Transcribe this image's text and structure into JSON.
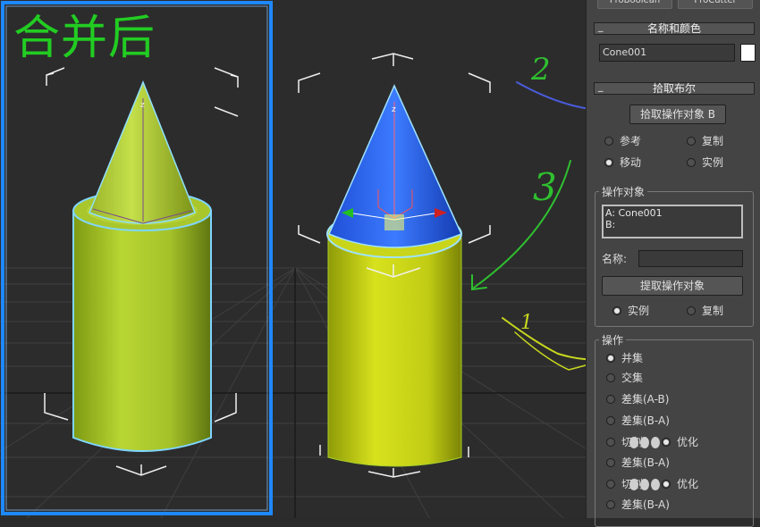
{
  "viewport": {
    "label_merged": "合并后",
    "annotations": {
      "num_2": "2",
      "num_3": "3",
      "num_1": "1"
    }
  },
  "panel": {
    "top_buttons": {
      "left": "ProBoolean",
      "right": "ProCutter"
    },
    "name_color": {
      "header": "名称和颜色",
      "object_name": "Cone001",
      "swatch_color": "#ffffff"
    },
    "pick_boolean": {
      "header": "拾取布尔",
      "pick_button": "拾取操作对象 B",
      "options": {
        "ref": "参考",
        "copy": "复制",
        "move": "移动",
        "instance": "实例"
      },
      "selected": "move"
    },
    "operands": {
      "title": "操作对象",
      "list": [
        "A: Cone001",
        "B:"
      ],
      "name_label": "名称:",
      "name_value": "",
      "extract_button": "提取操作对象",
      "opt_instance": "实例",
      "opt_copy": "复制",
      "selected": "instance"
    },
    "operation": {
      "title": "操作",
      "items": [
        "并集",
        "交集",
        "差集(A-B)",
        "差集(B-A)",
        "切割",
        "差集(B-A)",
        "切割",
        "差集(B-A)"
      ],
      "cut_option": "优化",
      "selected": 0
    }
  },
  "colors": {
    "viewport_bg": "#2b2b2b",
    "panel_bg": "#444444",
    "highlight_frame": "#1e88ff",
    "label_green": "#22cc22"
  }
}
